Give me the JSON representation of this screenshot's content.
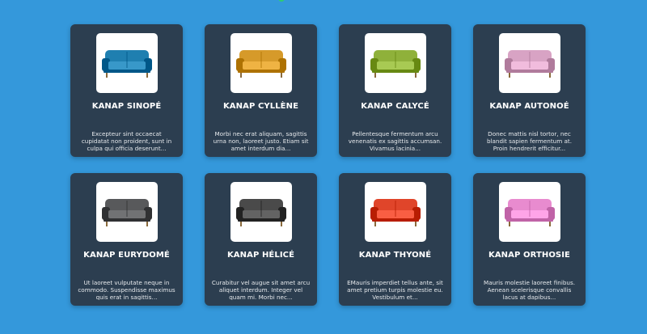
{
  "colors": {
    "background": "#3498db",
    "card": "#2c3e50",
    "thumb_bg": "#ffffff",
    "text": "#ffffff"
  },
  "products": [
    {
      "name": "KANAP SINOPÉ",
      "description": "Excepteur sint occaecat cupidatat non proident, sunt in culpa qui officia deserunt...",
      "image": "sofa-icon",
      "color": "#1f7fb0"
    },
    {
      "name": "KANAP CYLLÈNE",
      "description": "Morbi nec erat aliquam, sagittis urna non, laoreet justo. Etiam sit amet interdum dia...",
      "image": "sofa-icon",
      "color": "#d69a2a"
    },
    {
      "name": "KANAP CALYCÉ",
      "description": "Pellentesque fermentum arcu venenatis ex sagittis accumsan. Vivamus lacinia...",
      "image": "sofa-icon",
      "color": "#8fb13a"
    },
    {
      "name": "KANAP AUTONOÉ",
      "description": "Donec mattis nisl tortor, nec blandit sapien fermentum at. Proin hendrerit efficitur...",
      "image": "sofa-icon",
      "color": "#d8a3c4"
    },
    {
      "name": "KANAP EURYDOMÉ",
      "description": "Ut laoreet vulputate neque in commodo. Suspendisse maximus quis erat in sagittis...",
      "image": "sofa-icon",
      "color": "#58595b"
    },
    {
      "name": "KANAP HÉLICÉ",
      "description": "Curabitur vel augue sit amet arcu aliquet interdum. Integer vel quam mi. Morbi nec...",
      "image": "sofa-icon",
      "color": "#4a4a4a"
    },
    {
      "name": "KANAP THYONÉ",
      "description": "EMauris imperdiet tellus ante, sit amet pretium turpis molestie eu. Vestibulum et...",
      "image": "sofa-icon",
      "color": "#e0452a"
    },
    {
      "name": "KANAP ORTHOSIE",
      "description": "Mauris molestie laoreet finibus. Aenean scelerisque convallis lacus at dapibus...",
      "image": "sofa-icon",
      "color": "#e88bcf"
    }
  ]
}
